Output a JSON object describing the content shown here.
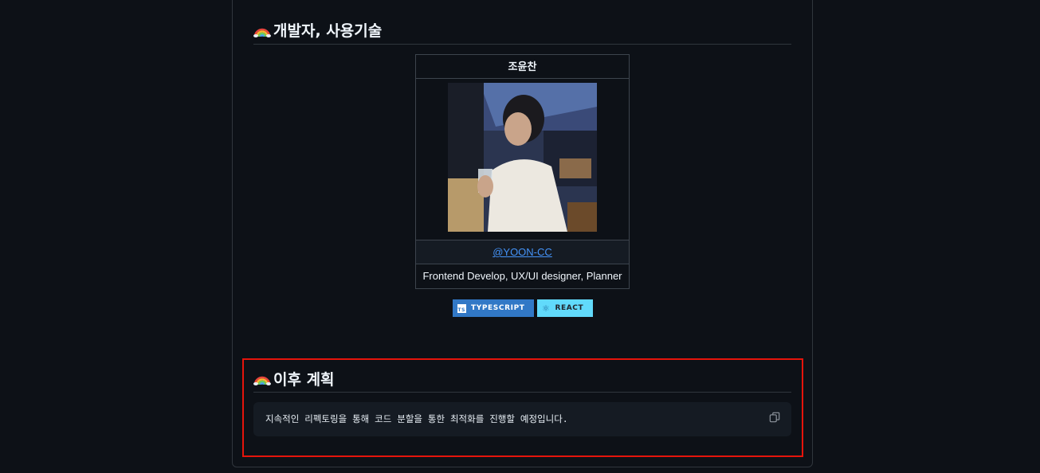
{
  "sections": {
    "developers": {
      "title": "개발자, 사용기술",
      "icon": "rainbow-icon"
    },
    "plans": {
      "title": "이후 계획",
      "icon": "rainbow-icon"
    }
  },
  "developer": {
    "name": "조윤찬",
    "photo": "profile-photo",
    "link_text": "@YOON-CC",
    "role": "Frontend Develop, UX/UI designer, Planner"
  },
  "badges": [
    {
      "label": "TYPESCRIPT",
      "icon": "typescript-icon",
      "color": "#3178c6"
    },
    {
      "label": "REACT",
      "icon": "react-icon",
      "color": "#61dafb"
    }
  ],
  "plan_text": "지속적인 리펙토링을 통해 코드 분할을 통한 최적화를 진행할 예정입니다.",
  "copy_icon": "copy-icon",
  "colors": {
    "background": "#0d1117",
    "highlight_border": "#e5140b",
    "link": "#4493f8"
  }
}
